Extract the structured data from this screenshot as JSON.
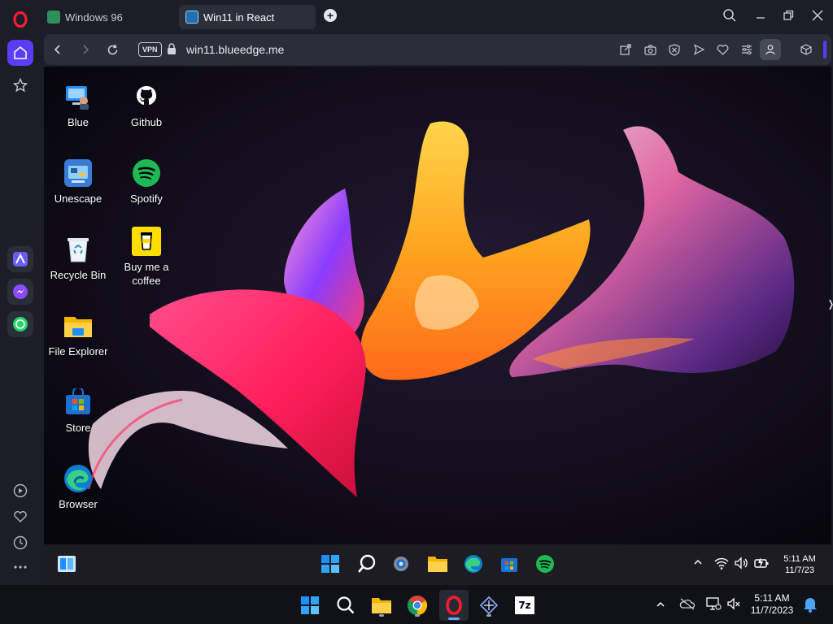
{
  "tabs": [
    {
      "label": "Windows 96"
    },
    {
      "label": "Win11 in React"
    }
  ],
  "address": {
    "vpn_label": "VPN",
    "url": "win11.blueedge.me"
  },
  "desktop_icons": [
    {
      "label": "Blue"
    },
    {
      "label": "Github"
    },
    {
      "label": "Unescape"
    },
    {
      "label": "Spotify"
    },
    {
      "label": "Recycle Bin"
    },
    {
      "label": "Buy me a coffee"
    },
    {
      "label": "File Explorer"
    },
    {
      "label": "Store"
    },
    {
      "label": "Browser"
    }
  ],
  "web_taskbar": {
    "time": "5:11 AM",
    "date": "11/7/23"
  },
  "host_taskbar": {
    "time": "5:11 AM",
    "date": "11/7/2023",
    "sevenzip_label": "7z"
  },
  "colors": {
    "opera_red": "#ff1b2d",
    "opera_accent": "#5b3df5",
    "windows_blue": "#1e8fff",
    "spotify_green": "#1db954"
  },
  "icons": [
    "opera-icon",
    "home-icon",
    "star-icon",
    "aria-icon",
    "messenger-icon",
    "whatsapp-icon",
    "player-icon",
    "heart-icon",
    "history-icon",
    "more-icon",
    "search-icon",
    "minimize-icon",
    "restore-icon",
    "close-icon",
    "back-icon",
    "forward-icon",
    "reload-icon",
    "lock-icon",
    "share-icon",
    "camera-icon",
    "shield-icon",
    "send-icon",
    "heart-icon",
    "menu-icon",
    "profile-icon",
    "box-icon",
    "windows-icon",
    "gear-icon",
    "folder-icon",
    "edge-icon",
    "store-icon",
    "spotify-icon",
    "wifi-icon",
    "volume-icon",
    "battery-icon",
    "chrome-icon",
    "notification-icon"
  ]
}
